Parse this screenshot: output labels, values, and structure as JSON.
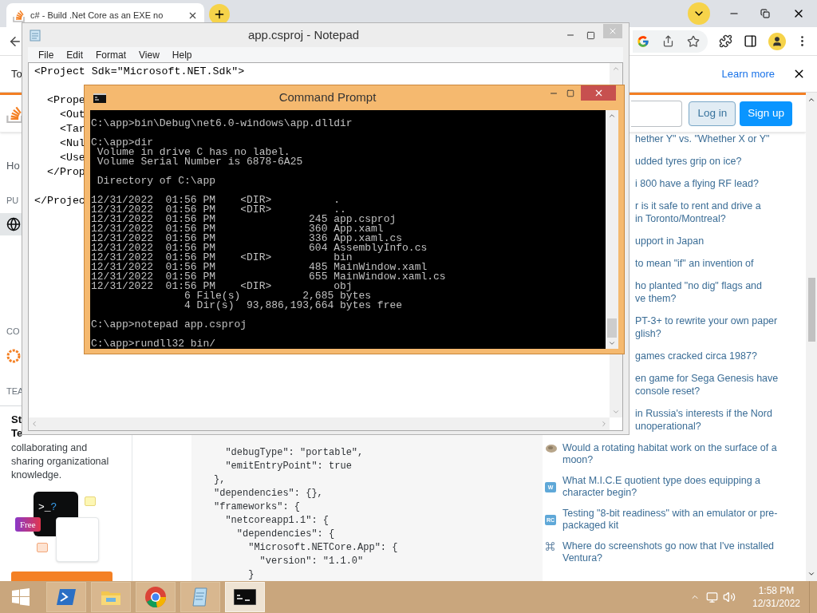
{
  "browser": {
    "tab": {
      "title": "c# - Build .Net Core as an EXE no"
    },
    "info_bar": {
      "text": "To",
      "link": "Learn more"
    },
    "header": {
      "buttons": [
        {
          "label": "Log in",
          "kind": "secondary"
        },
        {
          "label": "Sign up",
          "kind": "primary"
        }
      ]
    },
    "sidebar": {
      "home": "Ho",
      "groups": [
        {
          "heading": "PU",
          "items": [
            {
              "selected": true
            }
          ]
        },
        {
          "heading": "CO",
          "items": [
            {
              "selected": false
            }
          ]
        },
        {
          "heading": "TEA"
        }
      ],
      "card": {
        "title_lines": [
          "St",
          "Te"
        ],
        "text": "collaborating and sharing organizational knowledge.",
        "prompt": ">_",
        "prompt_mark": "?",
        "badge": "Free"
      }
    },
    "code_lines": [
      "  \"debugType\": \"portable\",",
      "  \"emitEntryPoint\": true",
      "},",
      "\"dependencies\": {},",
      "\"frameworks\": {",
      "  \"netcoreapp1.1\": {",
      "    \"dependencies\": {",
      "      \"Microsoft.NETCore.App\": {",
      "        \"version\": \"1.1.0\"",
      "      }"
    ],
    "questions": [
      {
        "kind": "fragment",
        "lines": [
          "hether Y\" vs. \"Whether X or Y\""
        ]
      },
      {
        "kind": "fragment",
        "lines": [
          "udded tyres grip on ice?"
        ]
      },
      {
        "kind": "fragment",
        "lines": [
          "i 800 have a flying RF lead?"
        ]
      },
      {
        "kind": "fragment",
        "lines": [
          "r is it safe to rent and drive a",
          "in Toronto/Montreal?"
        ]
      },
      {
        "kind": "fragment",
        "lines": [
          "upport in Japan"
        ]
      },
      {
        "kind": "fragment",
        "lines": [
          "to mean \"if\" an invention of"
        ]
      },
      {
        "kind": "fragment",
        "lines": [
          "ho planted \"no dig\" flags and",
          "ve them?"
        ]
      },
      {
        "kind": "fragment",
        "lines": [
          "PT-3+ to rewrite your own paper",
          "glish?"
        ]
      },
      {
        "kind": "fragment",
        "lines": [
          "games cracked circa 1987?"
        ]
      },
      {
        "kind": "fragment",
        "lines": [
          "en game for Sega Genesis have",
          "console reset?"
        ]
      },
      {
        "kind": "fragment",
        "lines": [
          "in Russia's interests if the Nord",
          "unoperational?"
        ]
      },
      {
        "kind": "image",
        "text": "Would a rotating habitat work on the surface of a moon?"
      },
      {
        "kind": "badge",
        "badge": "W",
        "text": "What M.I.C.E quotient type does equipping a character begin?"
      },
      {
        "kind": "badge",
        "badge": "RC",
        "text": "Testing \"8-bit readiness\" with an emulator or pre-packaged kit"
      },
      {
        "kind": "symbol",
        "text": "Where do screenshots go now that I've installed Ventura?"
      }
    ]
  },
  "notepad": {
    "title": "app.csproj - Notepad",
    "active": false,
    "menu": [
      "File",
      "Edit",
      "Format",
      "View",
      "Help"
    ],
    "blocks": [
      [
        "<Project Sdk=\"Microsoft.NET.Sdk\">"
      ],
      [
        "  <Prope",
        "    <Out",
        "    <Tar",
        "    <Nul",
        "    <Use",
        "  </Prop"
      ],
      [
        "</Projec"
      ]
    ]
  },
  "cmd": {
    "title": "Command Prompt",
    "active": true,
    "blocks": [
      [
        "C:\\app>bin\\Debug\\net6.0-windows\\app.dlldir"
      ],
      [
        "C:\\app>dir",
        " Volume in drive C has no label.",
        " Volume Serial Number is 6878-6A25"
      ],
      [
        " Directory of C:\\app"
      ],
      [
        "12/31/2022  01:56 PM    <DIR>          .",
        "12/31/2022  01:56 PM    <DIR>          ..",
        "12/31/2022  01:56 PM               245 app.csproj",
        "12/31/2022  01:56 PM               360 App.xaml",
        "12/31/2022  01:56 PM               336 App.xaml.cs",
        "12/31/2022  01:56 PM               604 AssemblyInfo.cs",
        "12/31/2022  01:56 PM    <DIR>          bin",
        "12/31/2022  01:56 PM               485 MainWindow.xaml",
        "12/31/2022  01:56 PM               655 MainWindow.xaml.cs",
        "12/31/2022  01:56 PM    <DIR>          obj",
        "               6 File(s)          2,685 bytes",
        "               4 Dir(s)  93,886,193,664 bytes free"
      ],
      [
        "C:\\app>notepad app.csproj"
      ],
      [
        "C:\\app>rundll32 bin/"
      ]
    ]
  },
  "taskbar": {
    "apps": [
      {
        "kind": "powershell",
        "active": false
      },
      {
        "kind": "explorer",
        "active": false
      },
      {
        "kind": "chrome",
        "active": false
      },
      {
        "kind": "notepad",
        "active": false
      },
      {
        "kind": "cmd",
        "active": true
      }
    ],
    "time": "1:58 PM",
    "date": "12/31/2022"
  }
}
